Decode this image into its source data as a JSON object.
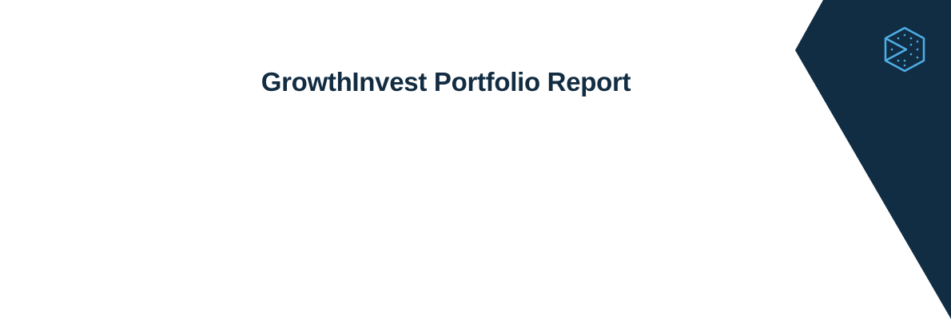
{
  "report": {
    "title": "GrowthInvest Portfolio Report"
  },
  "colors": {
    "navy": "#112d44",
    "logo_blue": "#4eaee6",
    "title_text": "#122c42"
  },
  "icons": {
    "brand_logo": "hexagon-logo-icon"
  }
}
